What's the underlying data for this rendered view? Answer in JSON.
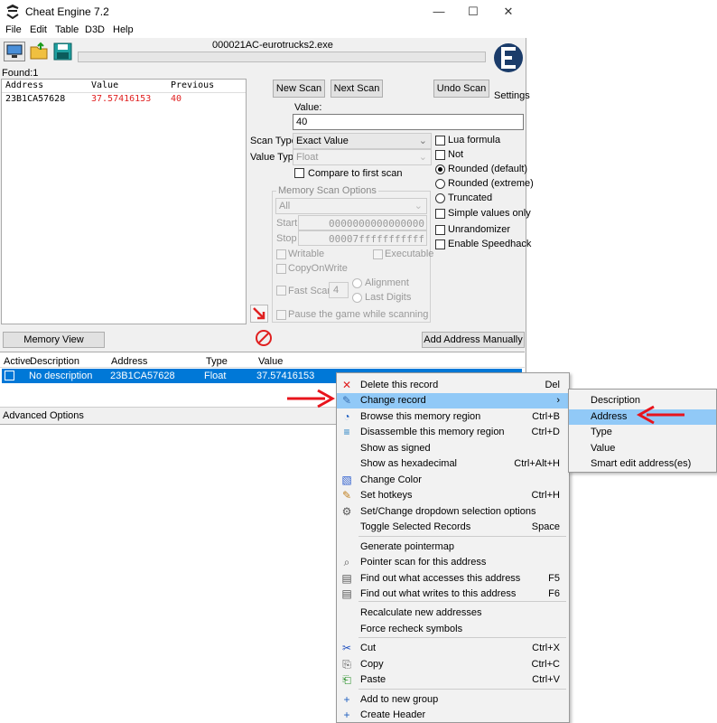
{
  "window": {
    "title": "Cheat Engine 7.2",
    "process_name": "000021AC-eurotrucks2.exe",
    "menu": [
      "File",
      "Edit",
      "Table",
      "D3D",
      "Help"
    ],
    "logo_caption": "Settings"
  },
  "found": "Found:1",
  "results": {
    "headers": [
      "Address",
      "Value",
      "Previous"
    ],
    "rows": [
      {
        "address": "23B1CA57628",
        "value": "37.57416153",
        "previous": "40"
      }
    ]
  },
  "scan": {
    "new_scan": "New Scan",
    "next_scan": "Next Scan",
    "undo_scan": "Undo Scan",
    "value_label": "Value:",
    "value": "40",
    "scan_type_label": "Scan Type",
    "scan_type": "Exact Value",
    "value_type_label": "Value Type",
    "value_type": "Float",
    "compare_first": "Compare to first scan",
    "lua_formula": "Lua formula",
    "not": "Not",
    "rounded_default": "Rounded (default)",
    "rounded_extreme": "Rounded (extreme)",
    "truncated": "Truncated",
    "simple_values": "Simple values only",
    "unrandomizer": "Unrandomizer",
    "speedhack": "Enable Speedhack"
  },
  "memory_options": {
    "title": "Memory Scan Options",
    "region": "All",
    "start_label": "Start",
    "start": "0000000000000000",
    "stop_label": "Stop",
    "stop": "00007fffffffffff",
    "writable": "Writable",
    "executable": "Executable",
    "copyonwrite": "CopyOnWrite",
    "fast_scan": "Fast Scan",
    "fast_scan_value": "4",
    "alignment": "Alignment",
    "last_digits": "Last Digits",
    "pause": "Pause the game while scanning"
  },
  "bottom": {
    "memory_view": "Memory View",
    "add_address": "Add Address Manually",
    "advanced": "Advanced Options"
  },
  "table": {
    "headers": [
      "Active",
      "Description",
      "Address",
      "Type",
      "Value"
    ],
    "rows": [
      {
        "description": "No description",
        "address": "23B1CA57628",
        "type": "Float",
        "value": "37.57416153"
      }
    ]
  },
  "context_menu": [
    {
      "label": "Delete this record",
      "shortcut": "Del",
      "icon": "delete-x-icon"
    },
    {
      "label": "Change record",
      "shortcut": "",
      "icon": "change-record-icon",
      "highlight": true,
      "submenu": true
    },
    {
      "label": "Browse this memory region",
      "shortcut": "Ctrl+B",
      "icon": "binoculars-icon"
    },
    {
      "label": "Disassemble this memory region",
      "shortcut": "Ctrl+D",
      "icon": "disassemble-icon"
    },
    {
      "label": "Show as signed",
      "shortcut": ""
    },
    {
      "label": "Show as hexadecimal",
      "shortcut": "Ctrl+Alt+H"
    },
    {
      "label": "Change Color",
      "shortcut": "",
      "icon": "color-icon"
    },
    {
      "label": "Set hotkeys",
      "shortcut": "Ctrl+H",
      "icon": "hotkey-icon"
    },
    {
      "label": "Set/Change dropdown selection options",
      "shortcut": "",
      "icon": "gear-icon"
    },
    {
      "label": "Toggle Selected Records",
      "shortcut": "Space"
    },
    {
      "label": "Generate pointermap",
      "shortcut": ""
    },
    {
      "label": "Pointer scan for this address",
      "shortcut": "",
      "icon": "pointer-scan-icon"
    },
    {
      "label": "Find out what accesses this address",
      "shortcut": "F5",
      "icon": "find-access-icon"
    },
    {
      "label": "Find out what writes to this address",
      "shortcut": "F6",
      "icon": "find-writes-icon"
    },
    {
      "label": "Recalculate new addresses",
      "shortcut": ""
    },
    {
      "label": "Force recheck symbols",
      "shortcut": ""
    },
    {
      "label": "Cut",
      "shortcut": "Ctrl+X",
      "icon": "scissors-icon"
    },
    {
      "label": "Copy",
      "shortcut": "Ctrl+C",
      "icon": "copy-icon"
    },
    {
      "label": "Paste",
      "shortcut": "Ctrl+V",
      "icon": "paste-icon"
    },
    {
      "label": "Add to new group",
      "shortcut": "",
      "icon": "plus-icon"
    },
    {
      "label": "Create Header",
      "shortcut": "",
      "icon": "plus-icon"
    }
  ],
  "submenu": [
    {
      "label": "Description"
    },
    {
      "label": "Address",
      "highlight": true
    },
    {
      "label": "Type"
    },
    {
      "label": "Value"
    },
    {
      "label": "Smart edit address(es)"
    }
  ],
  "colors": {
    "selection": "#0078d7",
    "menu_highlight": "#91c9f7",
    "value_red": "#e02020",
    "arrow_red": "#e8141c"
  }
}
